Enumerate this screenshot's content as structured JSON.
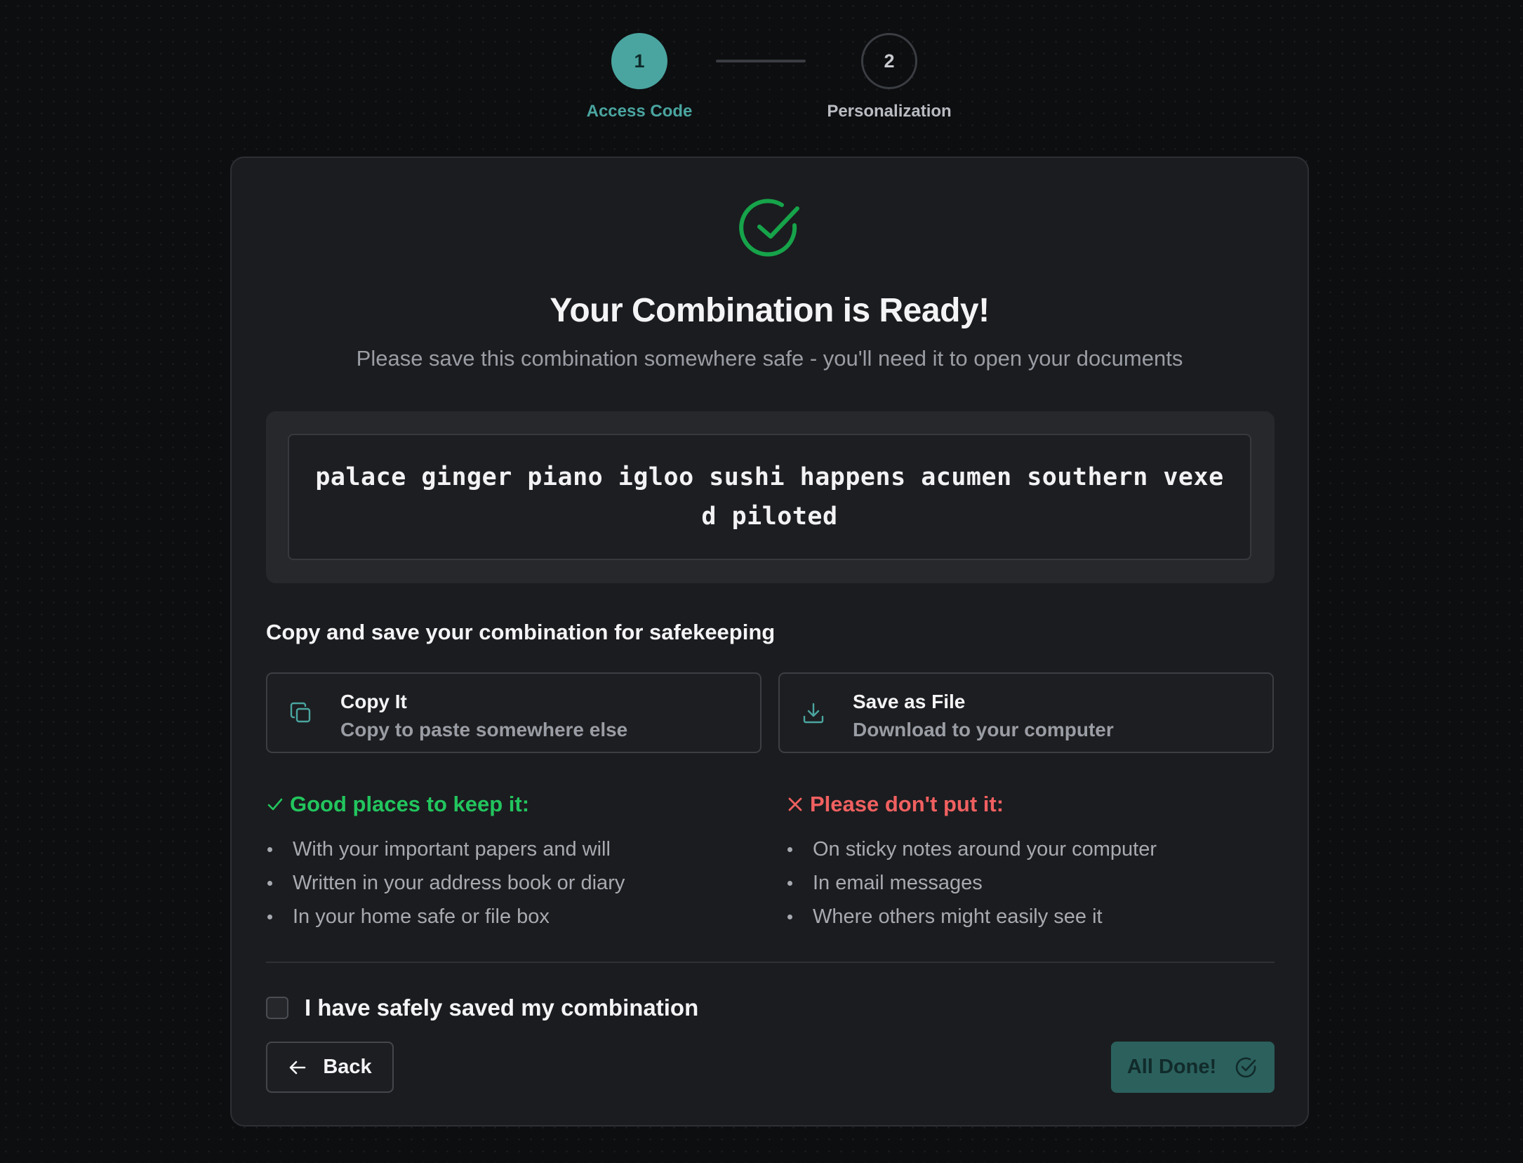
{
  "stepper": {
    "steps": [
      {
        "number": "1",
        "label": "Access Code",
        "state": "active"
      },
      {
        "number": "2",
        "label": "Personalization",
        "state": "inactive"
      }
    ]
  },
  "card": {
    "icon": "check-circle-icon",
    "title": "Your Combination is Ready!",
    "subtitle": "Please save this combination somewhere safe - you'll need it to open your documents",
    "combination": "palace ginger piano igloo sushi happens acumen southern vexed piloted",
    "save_heading": "Copy and save your combination for safekeeping",
    "actions": {
      "copy": {
        "icon": "copy-icon",
        "title": "Copy It",
        "description": "Copy to paste somewhere else"
      },
      "save": {
        "icon": "download-icon",
        "title": "Save as File",
        "description": "Download to your computer"
      }
    },
    "good_places": {
      "icon": "checkmark-icon",
      "heading": "Good places to keep it:",
      "items": [
        "With your important papers and will",
        "Written in your address book or diary",
        "In your home safe or file box"
      ]
    },
    "bad_places": {
      "icon": "x-icon",
      "heading": "Please don't put it:",
      "items": [
        "On sticky notes around your computer",
        "In email messages",
        "Where others might easily see it"
      ]
    },
    "confirmation": {
      "label": "I have safely saved my combination",
      "checked": false
    },
    "back_button": {
      "icon": "arrow-left-icon",
      "label": "Back"
    },
    "done_button": {
      "icon": "check-circle-icon",
      "label": "All Done!",
      "enabled": false
    }
  },
  "colors": {
    "accent": "#4aa5a0",
    "success": "#22c55e",
    "danger": "#f06060",
    "background": "#0d0e10",
    "card": "#1b1c1f"
  }
}
